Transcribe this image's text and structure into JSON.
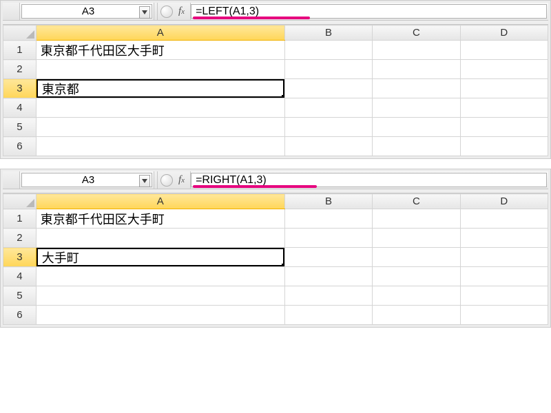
{
  "examples": [
    {
      "namebox": "A3",
      "formula": "=LEFT(A1,3)",
      "underlineWidthPx": 170,
      "columns": [
        "A",
        "B",
        "C",
        "D"
      ],
      "rows": [
        "1",
        "2",
        "3",
        "4",
        "5",
        "6"
      ],
      "activeCell": "A3",
      "cells": {
        "A1": "東京都千代田区大手町",
        "A3": "東京都"
      }
    },
    {
      "namebox": "A3",
      "formula": "=RIGHT(A1,3)",
      "underlineWidthPx": 180,
      "columns": [
        "A",
        "B",
        "C",
        "D"
      ],
      "rows": [
        "1",
        "2",
        "3",
        "4",
        "5",
        "6"
      ],
      "activeCell": "A3",
      "cells": {
        "A1": "東京都千代田区大手町",
        "A3": "大手町"
      }
    }
  ],
  "icons": {
    "dropdown": "chevron-down-icon",
    "fx": "fx-icon"
  }
}
